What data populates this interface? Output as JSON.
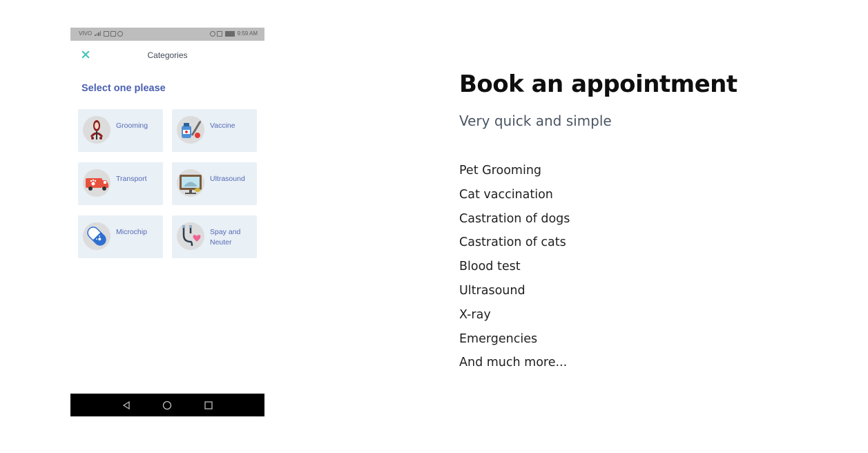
{
  "phone": {
    "status_bar": {
      "carrier": "VIVO",
      "time": "9:59 AM"
    },
    "header": {
      "title": "Categories",
      "close_icon": "close-icon"
    },
    "heading": "Select one please",
    "categories": [
      {
        "label": "Grooming",
        "icon": "grooming-icon"
      },
      {
        "label": "Vaccine",
        "icon": "vaccine-icon"
      },
      {
        "label": "Transport",
        "icon": "transport-icon"
      },
      {
        "label": "Ultrasound",
        "icon": "ultrasound-icon"
      },
      {
        "label": "Microchip",
        "icon": "microchip-icon"
      },
      {
        "label": "Spay and Neuter",
        "icon": "stethoscope-icon"
      }
    ],
    "nav_bar": [
      "back-icon",
      "home-icon",
      "recent-apps-icon"
    ]
  },
  "content": {
    "title": "Book an appointment",
    "subtitle": "Very quick and simple",
    "features": [
      "Pet Grooming",
      "Cat vaccination",
      "Castration of dogs",
      "Castration of cats",
      "Blood test",
      "Ultrasound",
      "X-ray",
      "Emergencies",
      "And much more..."
    ]
  },
  "colors": {
    "accent_teal": "#3cc4b4",
    "heading_blue": "#4a5fb0",
    "card_background": "#e9f0f6",
    "status_bar_gray": "#bdbdbd",
    "nav_bar": "#000000"
  }
}
